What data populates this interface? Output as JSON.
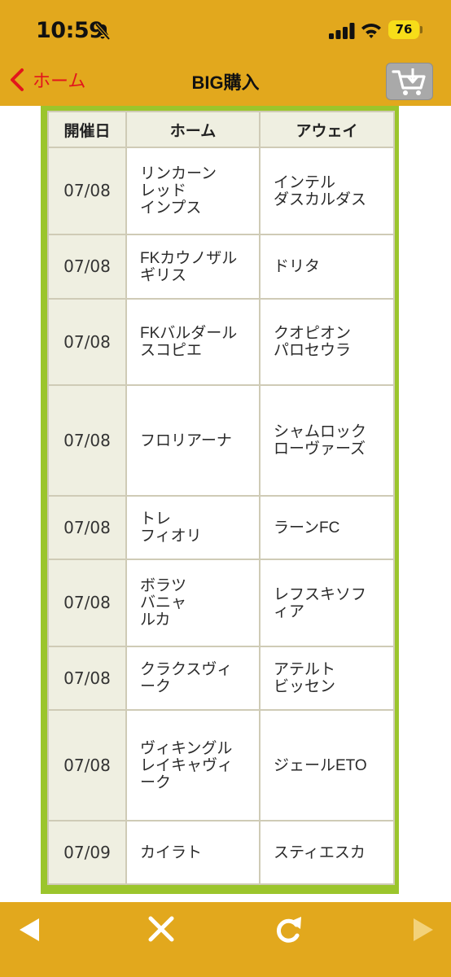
{
  "status_bar": {
    "time": "10:59",
    "battery": "76"
  },
  "header": {
    "back_label": "ホーム",
    "title": "BIG購入"
  },
  "table": {
    "columns": [
      "開催日",
      "ホーム",
      "アウェイ"
    ],
    "rows": [
      {
        "date": "07/08",
        "home": "リンカーン\nレッド\nインプス",
        "away": "インテル\nダスカルダス"
      },
      {
        "date": "07/08",
        "home": "FKカウノザル\nギリス",
        "away": "ドリタ"
      },
      {
        "date": "07/08",
        "home": "FKバルダール\nスコピエ",
        "away": "クオピオン\nパロセウラ"
      },
      {
        "date": "07/08",
        "home": "フロリアーナ",
        "away": "シャムロック\nローヴァーズ"
      },
      {
        "date": "07/08",
        "home": "トレ\nフィオリ",
        "away": "ラーンFC"
      },
      {
        "date": "07/08",
        "home": "ボラツ\nバニャ\nルカ",
        "away": "レフスキソフ\nィア"
      },
      {
        "date": "07/08",
        "home": "クラクスヴィ\nーク",
        "away": "アテルト\nビッセン"
      },
      {
        "date": "07/08",
        "home": "ヴィキングル\nレイキャヴィ\nーク",
        "away": "ジェールETO"
      },
      {
        "date": "07/09",
        "home": "カイラト",
        "away": "スティエスカ"
      }
    ]
  },
  "colors": {
    "accent": "#e2a81d",
    "frame": "#9bc52c",
    "back_link": "#e2161c"
  }
}
